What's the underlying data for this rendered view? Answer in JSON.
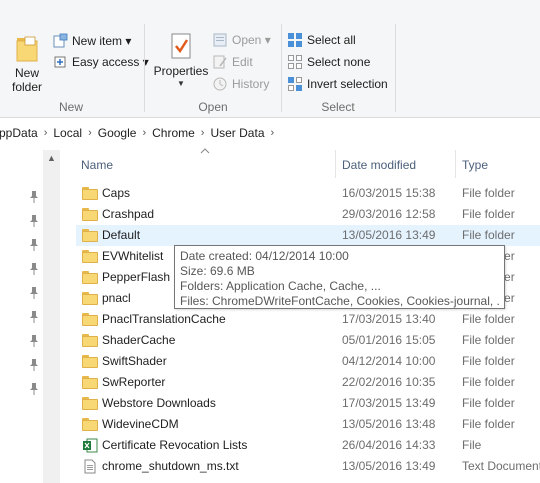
{
  "ribbon": {
    "new_group": {
      "label": "New",
      "new_folder_label": "New\nfolder",
      "new_item_label": "New item ▾",
      "easy_access_label": "Easy access ▾"
    },
    "open_group": {
      "label": "Open",
      "properties_label": "Properties",
      "open_label": "Open ▾",
      "edit_label": "Edit",
      "history_label": "History"
    },
    "select_group": {
      "label": "Select",
      "select_all_label": "Select all",
      "select_none_label": "Select none",
      "invert_label": "Invert selection"
    }
  },
  "address": {
    "crumbs": [
      "ppData",
      "Local",
      "Google",
      "Chrome",
      "User Data"
    ]
  },
  "columns": {
    "name": "Name",
    "date": "Date modified",
    "type": "Type"
  },
  "files": [
    {
      "name": "Caps",
      "date": "16/03/2015 15:38",
      "type": "File folder",
      "icon": "folder-icon"
    },
    {
      "name": "Crashpad",
      "date": "29/03/2016 12:58",
      "type": "File folder",
      "icon": "folder-icon"
    },
    {
      "name": "Default",
      "date": "13/05/2016 13:49",
      "type": "File folder",
      "icon": "folder-icon"
    },
    {
      "name": "EVWhitelist",
      "date": "",
      "type": "File folder",
      "icon": "folder-icon"
    },
    {
      "name": "PepperFlash",
      "date": "",
      "type": "File folder",
      "icon": "folder-icon"
    },
    {
      "name": "pnacl",
      "date": "",
      "type": "File folder",
      "icon": "folder-icon"
    },
    {
      "name": "PnaclTranslationCache",
      "date": "17/03/2015 13:40",
      "type": "File folder",
      "icon": "folder-icon"
    },
    {
      "name": "ShaderCache",
      "date": "05/01/2016 15:05",
      "type": "File folder",
      "icon": "folder-icon"
    },
    {
      "name": "SwiftShader",
      "date": "04/12/2014 10:00",
      "type": "File folder",
      "icon": "folder-icon"
    },
    {
      "name": "SwReporter",
      "date": "22/02/2016 10:35",
      "type": "File folder",
      "icon": "folder-icon"
    },
    {
      "name": "Webstore Downloads",
      "date": "17/03/2015 13:49",
      "type": "File folder",
      "icon": "folder-icon"
    },
    {
      "name": "WidevineCDM",
      "date": "13/05/2016 13:48",
      "type": "File folder",
      "icon": "folder-icon"
    },
    {
      "name": "Certificate Revocation Lists",
      "date": "26/04/2016 14:33",
      "type": "File",
      "icon": "excel-file-icon"
    },
    {
      "name": "chrome_shutdown_ms.txt",
      "date": "13/05/2016 13:49",
      "type": "Text Document",
      "icon": "text-file-icon"
    }
  ],
  "tooltip": {
    "line1": "Date created: 04/12/2014 10:00",
    "line2": "Size: 69.6 MB",
    "line3": "Folders: Application Cache, Cache, ...",
    "line4": "Files: ChromeDWriteFontCache, Cookies, Cookies-journal, ..."
  },
  "colors": {
    "hover_row": "#e5f3ff",
    "column_header_text": "#4c607a",
    "folder_yellow": "#f8d775"
  }
}
